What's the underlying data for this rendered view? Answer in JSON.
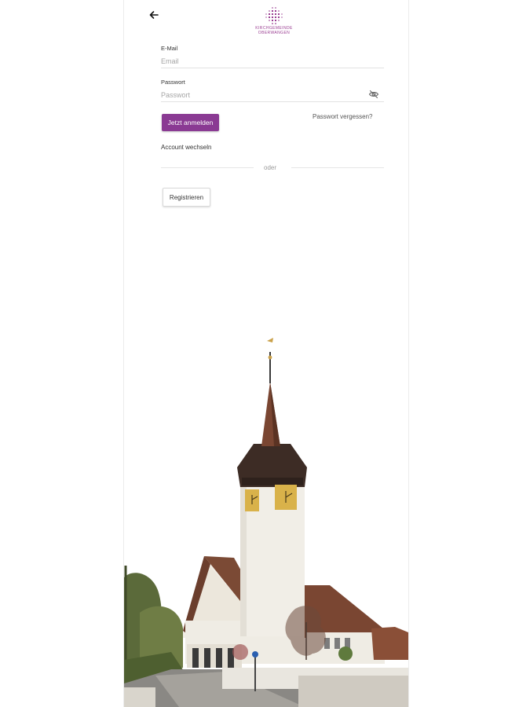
{
  "header": {
    "back_icon": "arrow-left-icon",
    "logo": {
      "line1": "KIRCHGEMEINDE",
      "line2": "OBERWANGEN",
      "color": "#9b3f93"
    }
  },
  "form": {
    "email": {
      "label": "E-Mail",
      "placeholder": "Email",
      "value": ""
    },
    "password": {
      "label": "Passwort",
      "placeholder": "Passwort",
      "value": "",
      "toggle_icon": "eye-off-icon"
    },
    "login_label": "Jetzt anmelden",
    "forgot_label": "Passwort vergessen?",
    "switch_account_label": "Account wechseln",
    "divider_label": "oder",
    "register_label": "Registrieren"
  },
  "theme": {
    "accent": "#8a3a93"
  }
}
